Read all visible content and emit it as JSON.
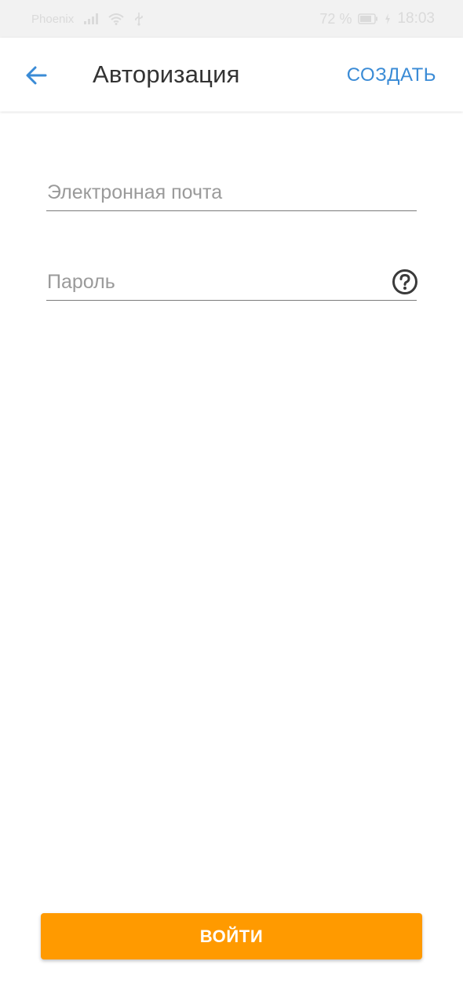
{
  "status_bar": {
    "carrier": "Phoenix",
    "battery_percent": "72 %",
    "time": "18:03"
  },
  "header": {
    "title": "Авторизация",
    "create_label": "СОЗДАТЬ",
    "back_icon": "arrow-left-icon"
  },
  "form": {
    "email": {
      "placeholder": "Электронная почта",
      "value": ""
    },
    "password": {
      "placeholder": "Пароль",
      "value": "",
      "help_icon": "question-circle-icon"
    }
  },
  "actions": {
    "login_label": "ВОЙТИ"
  },
  "colors": {
    "accent": "#3a8bd6",
    "primary_button": "#ff9a00",
    "status_bar_bg": "#f2f2f2"
  }
}
